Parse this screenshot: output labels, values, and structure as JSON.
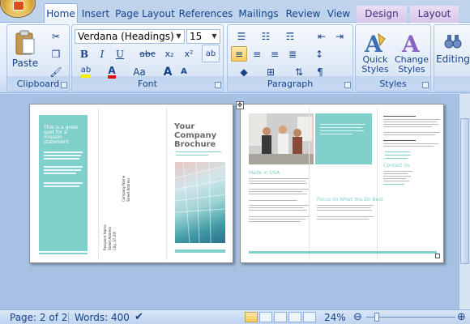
{
  "tabs": [
    {
      "label": "Home",
      "active": true
    },
    {
      "label": "Insert"
    },
    {
      "label": "Page Layout"
    },
    {
      "label": "References"
    },
    {
      "label": "Mailings"
    },
    {
      "label": "Review"
    },
    {
      "label": "View"
    },
    {
      "label": "Design",
      "contextual": true
    },
    {
      "label": "Layout",
      "contextual": true
    }
  ],
  "clipboard": {
    "paste": "Paste",
    "label": "Clipboard"
  },
  "font": {
    "name": "Verdana (Headings)",
    "size": "15",
    "label": "Font",
    "bold": "B",
    "italic": "I",
    "underline": "U",
    "strike": "abc",
    "sub": "x₂",
    "sup": "x²",
    "grow": "A",
    "shrink": "A",
    "case": "Aa",
    "color_font": "A"
  },
  "paragraph": {
    "label": "Paragraph"
  },
  "styles": {
    "quick": "Quick Styles",
    "change": "Change Styles",
    "label": "Styles"
  },
  "editing": {
    "label": "Editing"
  },
  "document": {
    "page1": {
      "panel_title": "This is a great spot for a mission statement",
      "company": "Your Company Brochure"
    },
    "page2": {
      "section1": "Made in USA",
      "section2": "Focus on What You Do Best",
      "contact": "Contact Us"
    }
  },
  "status": {
    "page": "Page: 2 of 2",
    "words": "Words: 400",
    "zoom": "24%"
  },
  "colors": {
    "teal": "#7fcfca",
    "ribbon_text": "#15428b"
  }
}
